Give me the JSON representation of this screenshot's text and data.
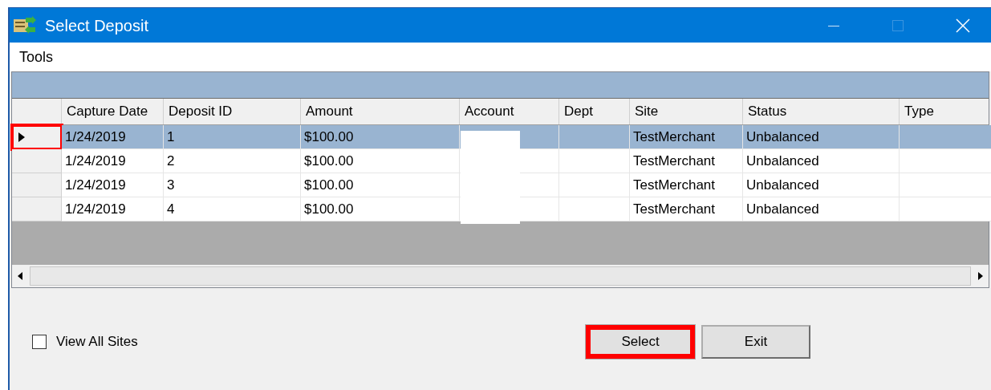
{
  "window": {
    "title": "Select Deposit"
  },
  "menu": [
    "Tools"
  ],
  "table": {
    "columns": [
      "Capture Date",
      "Deposit ID",
      "Amount",
      "Account",
      "Dept",
      "Site",
      "Status",
      "Type"
    ],
    "rows": [
      {
        "selected": true,
        "cells": [
          "1/24/2019",
          "1",
          "$100.00",
          "",
          "",
          "TestMerchant",
          "Unbalanced",
          ""
        ]
      },
      {
        "selected": false,
        "cells": [
          "1/24/2019",
          "2",
          "$100.00",
          "",
          "",
          "TestMerchant",
          "Unbalanced",
          ""
        ]
      },
      {
        "selected": false,
        "cells": [
          "1/24/2019",
          "3",
          "$100.00",
          "",
          "",
          "TestMerchant",
          "Unbalanced",
          ""
        ]
      },
      {
        "selected": false,
        "cells": [
          "1/24/2019",
          "4",
          "$100.00",
          "",
          "",
          "TestMerchant",
          "Unbalanced",
          ""
        ]
      }
    ]
  },
  "view_all_sites": {
    "label": "View All Sites",
    "checked": false
  },
  "buttons": [
    {
      "label": "Select",
      "highlighted": true
    },
    {
      "label": "Exit",
      "highlighted": false
    }
  ]
}
